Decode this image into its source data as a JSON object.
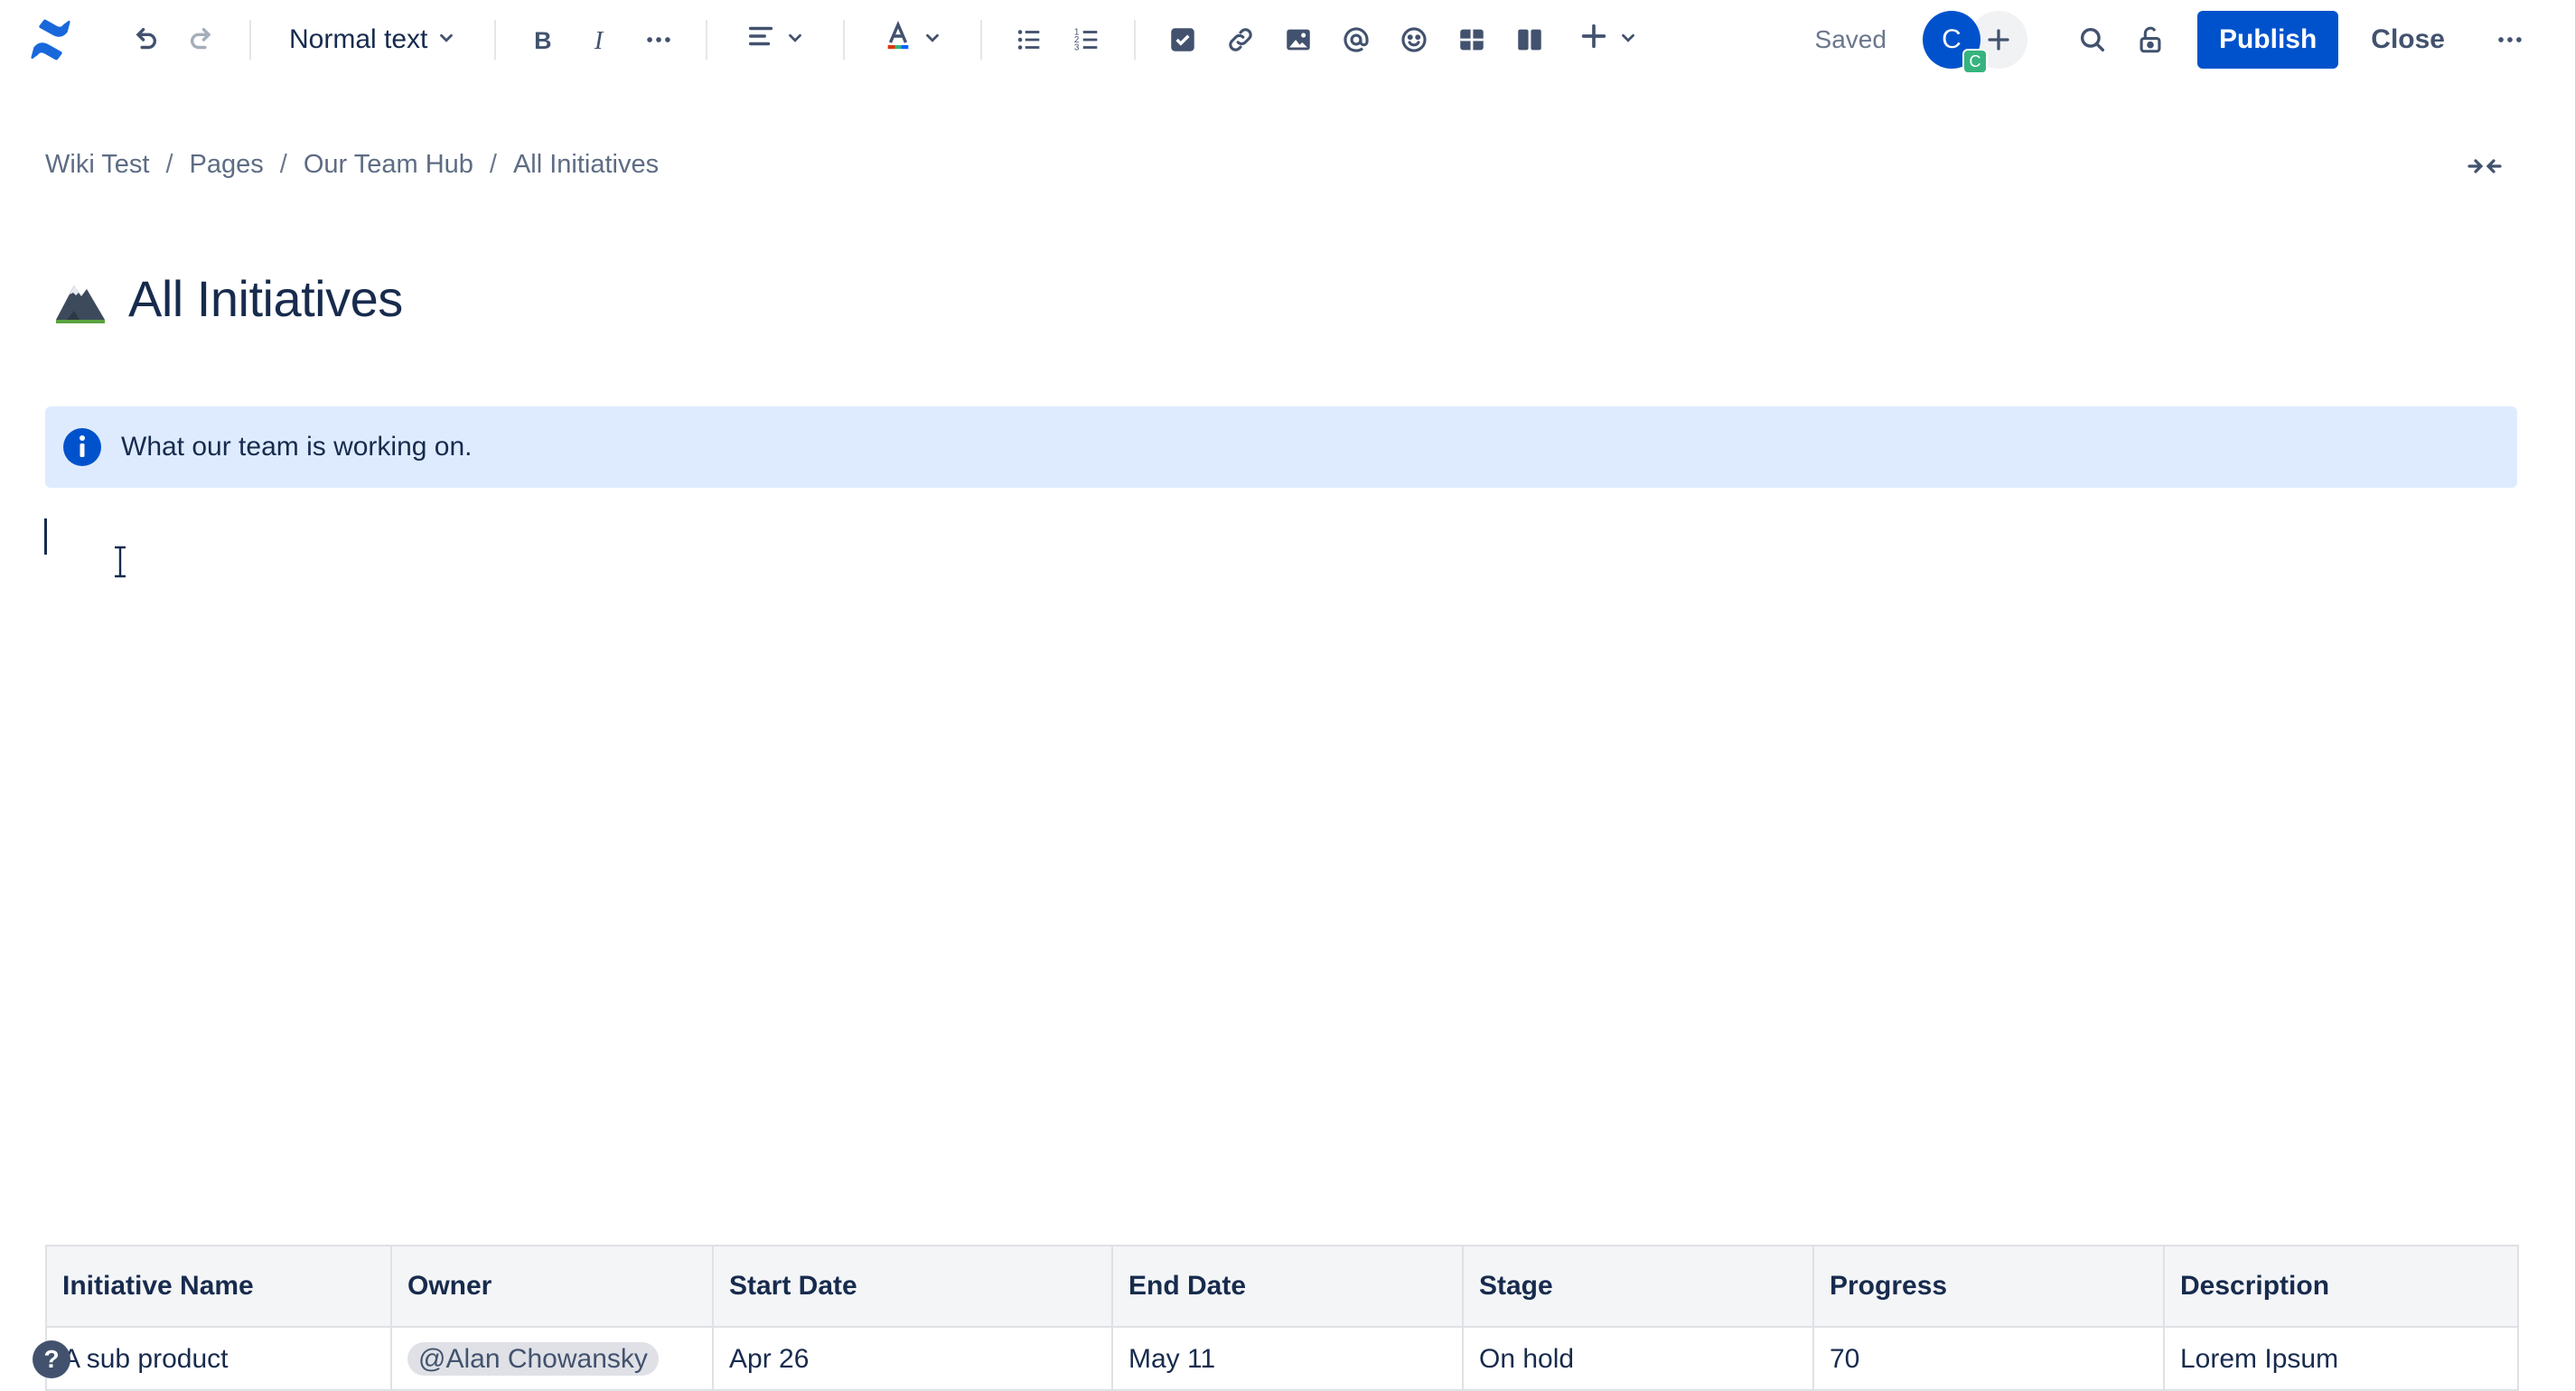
{
  "toolbar": {
    "text_style": "Normal text",
    "status": "Saved",
    "avatar_initial": "C",
    "avatar_badge": "C",
    "publish_label": "Publish",
    "close_label": "Close",
    "icons": [
      "confluence-logo",
      "undo",
      "redo",
      "bold",
      "italic",
      "more-formatting",
      "align",
      "text-color",
      "bullet-list",
      "numbered-list",
      "task",
      "link",
      "image",
      "mention",
      "emoji",
      "table",
      "layouts",
      "insert",
      "search",
      "restrictions",
      "more"
    ]
  },
  "breadcrumb": {
    "items": [
      "Wiki Test",
      "Pages",
      "Our Team Hub",
      "All Initiatives"
    ],
    "separator": "/"
  },
  "page": {
    "title": "All Initiatives",
    "emoji": "mountain-emoji"
  },
  "info_panel": {
    "text": "What our team is working on."
  },
  "table": {
    "headers": [
      "Initiative Name",
      "Owner",
      "Start Date",
      "End Date",
      "Stage",
      "Progress",
      "Description"
    ],
    "rows": [
      {
        "name": "A sub product",
        "owner": "@Alan Chowansky",
        "start": "Apr 26",
        "end": "May 11",
        "stage": "On hold",
        "progress": "70",
        "description": "Lorem Ipsum"
      }
    ]
  },
  "help": {
    "label": "?"
  },
  "colors": {
    "brand": "#0052cc",
    "info_bg": "#deebff",
    "text": "#172b4d",
    "subtle": "#5e6c84"
  }
}
